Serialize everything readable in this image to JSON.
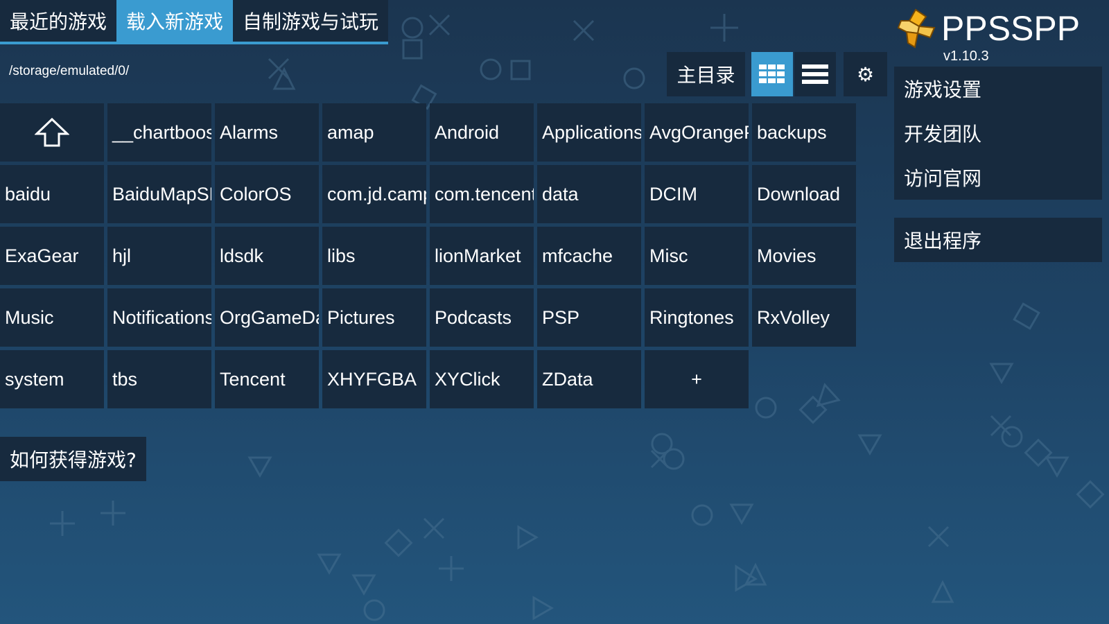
{
  "tabs": [
    {
      "label": "最近的游戏"
    },
    {
      "label": "载入新游戏"
    },
    {
      "label": "自制游戏与试玩"
    }
  ],
  "path": "/storage/emulated/0/",
  "toolbar": {
    "home_label": "主目录",
    "grid_icon": "grid-view-icon",
    "list_icon": "list-view-icon",
    "settings_icon": "gear-icon"
  },
  "files": [
    "__chartboost",
    "Alarms",
    "amap",
    "Android",
    "Applications",
    "AvgOrangePE",
    "backups",
    "baidu",
    "BaiduMapSDK",
    "ColorOS",
    "com.jd.camp",
    "com.tencent.",
    "data",
    "DCIM",
    "Download",
    "ExaGear",
    "hjl",
    "ldsdk",
    "libs",
    "lionMarket",
    "mfcache",
    "Misc",
    "Movies",
    "Music",
    "Notifications",
    "OrgGameData",
    "Pictures",
    "Podcasts",
    "PSP",
    "Ringtones",
    "RxVolley",
    "system",
    "tbs",
    "Tencent",
    "XHYFGBA",
    "XYClick",
    "ZData"
  ],
  "add_label": "+",
  "help_label": "如何获得游戏?",
  "logo": {
    "name": "PPSSPP",
    "version": "v1.10.3"
  },
  "menu": {
    "items": [
      {
        "label": "游戏设置"
      },
      {
        "label": "开发团队"
      },
      {
        "label": "访问官网"
      }
    ],
    "exit_label": "退出程序"
  },
  "colors": {
    "accent": "#3a9bd0",
    "panel": "#172a3e",
    "bg_top": "#1b3550",
    "bg_bottom": "#23557c"
  }
}
